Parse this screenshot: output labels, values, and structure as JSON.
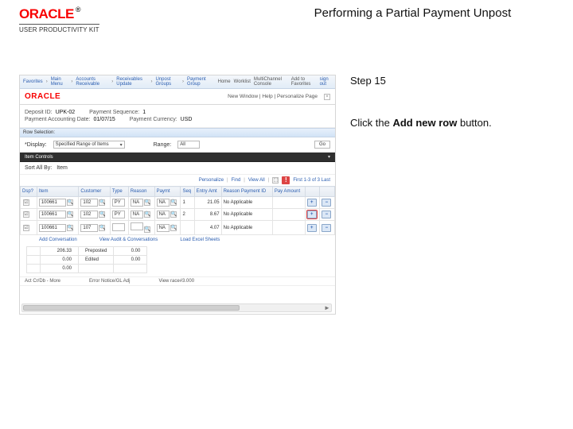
{
  "header": {
    "kit_label": "USER PRODUCTIVITY KIT",
    "title": "Performing a Partial Payment Unpost"
  },
  "instructions": {
    "step": "Step 15",
    "line_prefix": "Click the ",
    "button_name": "Add new row",
    "line_suffix": " button."
  },
  "app": {
    "topnav": {
      "items": [
        "Favorites",
        "Main Menu",
        "Accounts Receivable",
        "Receivables Update",
        "Unpost Groups",
        "Payment Group"
      ],
      "home": "Home",
      "worklist": "Worklist",
      "multichannel": "MultiChannel Console",
      "add_fav": "Add to Favorites",
      "signout": "sign out"
    },
    "branding": {
      "crumb": "New Window | Help | Personalize Page"
    },
    "group_info": {
      "deposit_id_k": "Deposit ID:",
      "deposit_id_v": "UPK-02",
      "payment_seq_k": "Payment Sequence:",
      "payment_seq_v": "1",
      "acct_date_k": "Payment Accounting Date:",
      "acct_date_v": "01/07/15",
      "currency_k": "Payment Currency:",
      "currency_v": "USD"
    },
    "row_selection": {
      "label": "Row Selection:",
      "display_k": "*Display:",
      "display_v": "Specified Range of Items",
      "range_k": "Range:",
      "range_v": "All",
      "go": "Go"
    },
    "item_bar": "Item Controls",
    "sort_bar": {
      "label": "Sort All By:",
      "value": "Item"
    },
    "toolbar": {
      "personalize": "Personalize",
      "find": "Find",
      "viewall": "View All",
      "pager": "First 1-3 of 3 Last"
    },
    "grid": {
      "headers": [
        "Dsp?",
        "Item",
        "Customer",
        "Type",
        "Reason",
        "Paymt",
        "Seq",
        "Entry Amt",
        "Reason Payment ID",
        "Pay Amount",
        "",
        ""
      ],
      "rows": [
        {
          "dsp": true,
          "item": "100661",
          "cust": "102",
          "type": "PY",
          "reason": "NA",
          "pmt": "NA",
          "seq": "1",
          "amt": "21.05",
          "refid": "No Applicable",
          "pay": "",
          "hl": false
        },
        {
          "dsp": true,
          "item": "100661",
          "cust": "102",
          "type": "PY",
          "reason": "NA",
          "pmt": "NA",
          "seq": "2",
          "amt": "8.67",
          "refid": "No Applicable",
          "pay": "",
          "hl": true
        },
        {
          "dsp": true,
          "item": "100661",
          "cust": "107",
          "type": "",
          "reason": "",
          "pmt": "NA",
          "seq": "",
          "amt": "4.07",
          "refid": "No Applicable",
          "pay": "",
          "hl": false
        }
      ]
    },
    "links": {
      "a": "Add Conversation",
      "b": "View Audit & Conversations",
      "c": "Load Excel Sheets"
    },
    "totals": {
      "headers": [
        "",
        "",
        "",
        ""
      ],
      "rows": [
        {
          "label": "",
          "target": "206.33",
          "status": "Preposted",
          "cur": "0.00"
        },
        {
          "label": "",
          "target": "0.00",
          "status": "Edited",
          "cur": "0.00"
        },
        {
          "label": "",
          "target": "0.00",
          "status": "",
          "cur": ""
        }
      ]
    },
    "messages": {
      "label": "Act Cr/Db - More",
      "text": "Error Notice/GL Adj",
      "suffix": "View race#3.000"
    }
  }
}
